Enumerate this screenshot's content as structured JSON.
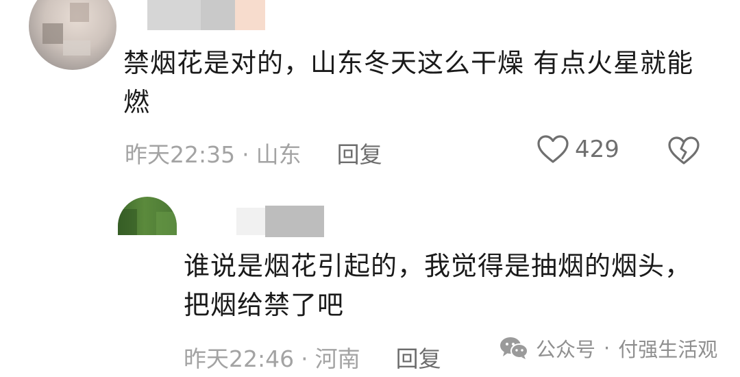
{
  "comments": [
    {
      "text": "禁烟花是对的，山东冬天这么干燥 有点火星就能燃",
      "time": "昨天22:35",
      "location": "山东",
      "reply_label": "回复",
      "likes": "429"
    },
    {
      "text": "谁说是烟花引起的，我觉得是抽烟的烟头，把烟给禁了吧",
      "time": "昨天22:46",
      "location": "河南",
      "reply_label": "回复"
    }
  ],
  "separator": "·",
  "watermark": {
    "prefix": "公众号",
    "name": "付强生活观"
  },
  "icons": {
    "like": "heart-outline-icon",
    "dislike": "broken-heart-icon",
    "watermark": "wechat-icon"
  },
  "colors": {
    "text": "#1a1a1a",
    "meta": "#a3a3a3",
    "reply": "#6d6d6d"
  }
}
